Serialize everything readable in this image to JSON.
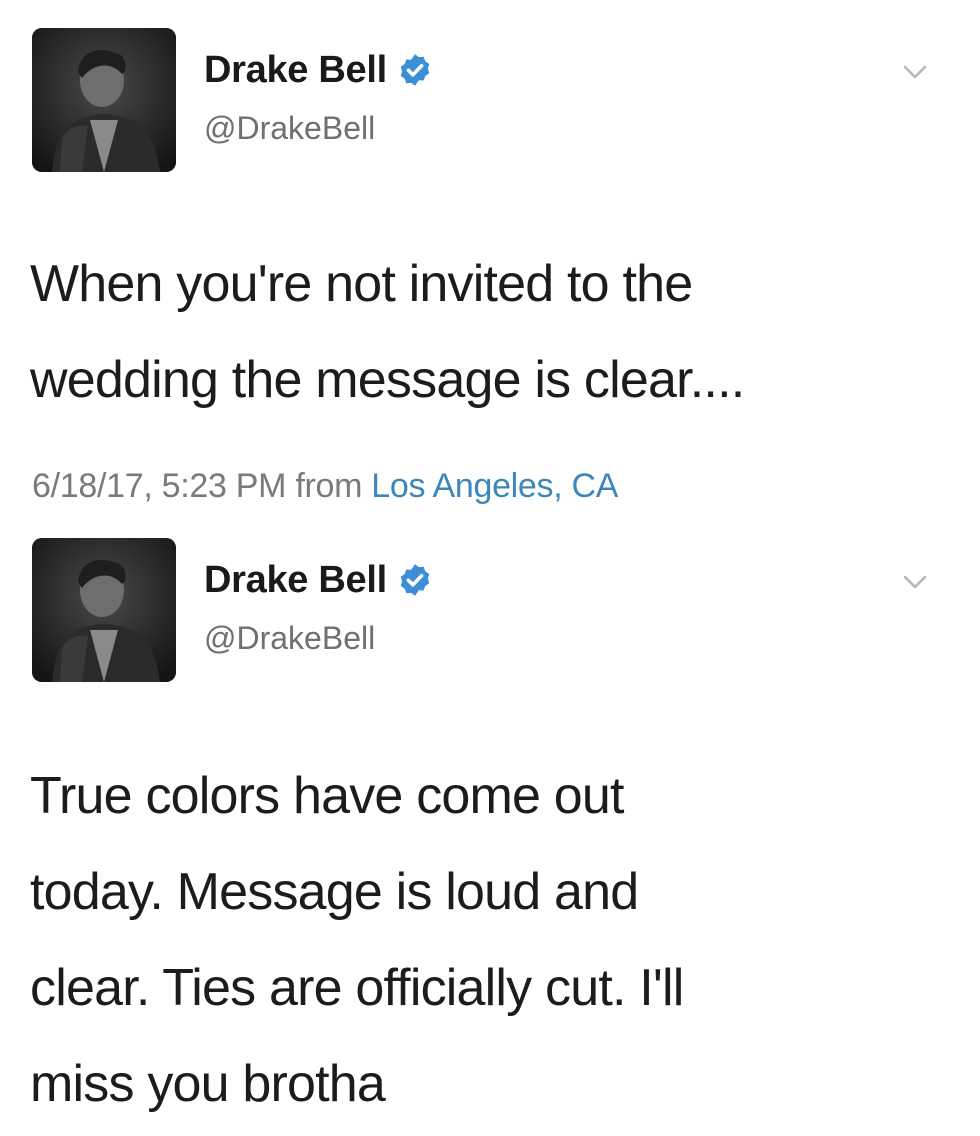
{
  "tweets": [
    {
      "author": {
        "display_name": "Drake Bell",
        "handle": "@DrakeBell",
        "verified": true
      },
      "text": "When you're not invited to the\nwedding the message is clear....",
      "timestamp": "6/18/17, 5:23 PM",
      "from_label": "from",
      "location": "Los Angeles, CA"
    },
    {
      "author": {
        "display_name": "Drake Bell",
        "handle": "@DrakeBell",
        "verified": true
      },
      "text": "True colors have come out\ntoday. Message is loud and\nclear. Ties are officially cut. I'll\nmiss you brotha"
    }
  ],
  "colors": {
    "verified_badge": "#3a8fd6",
    "link": "#3d87b8",
    "secondary_text": "#707070"
  },
  "icons": [
    "avatar-photo",
    "verified-badge-icon",
    "chevron-down-icon"
  ]
}
